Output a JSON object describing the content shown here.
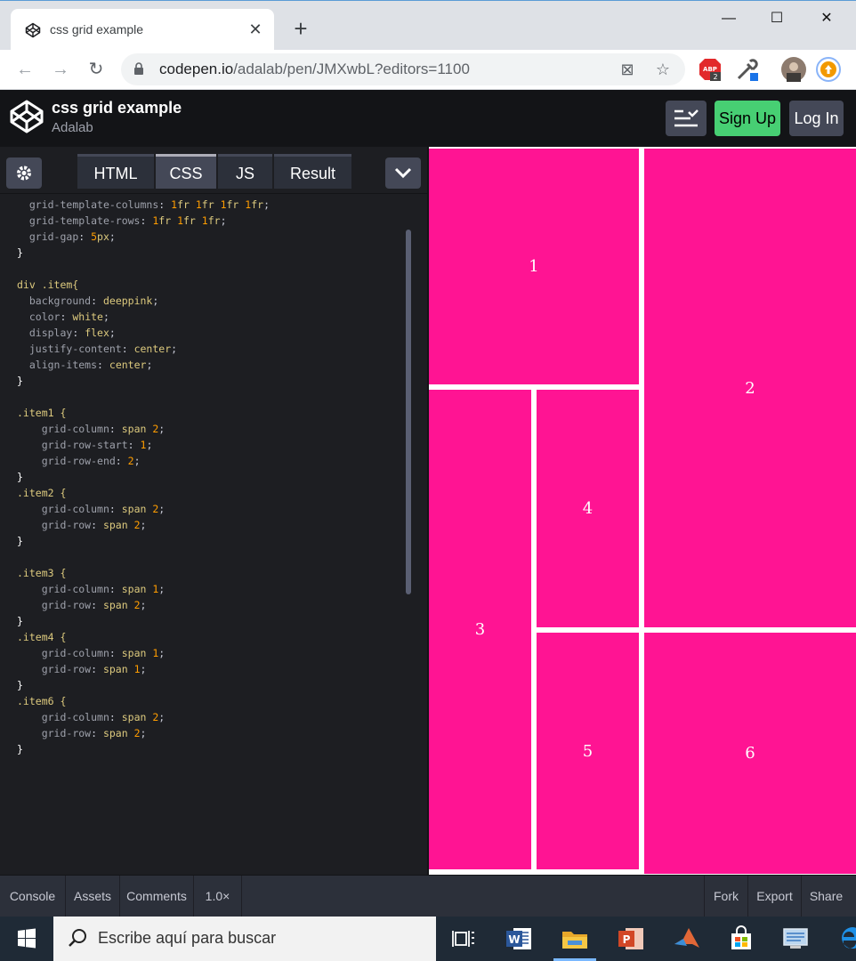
{
  "browser": {
    "tab_title": "css grid example",
    "tab_close": "✕",
    "new_tab": "+",
    "url_host": "codepen.io",
    "url_path": "/adalab/pen/JMXwbL?editors=1100",
    "window_controls": {
      "minimize": "—",
      "maximize": "☐",
      "close": "✕"
    },
    "extension_badge": "2"
  },
  "codepen": {
    "title": "css grid example",
    "author": "Adalab",
    "signup_label": "Sign Up",
    "login_label": "Log In",
    "editor_tabs": [
      "HTML",
      "CSS",
      "JS",
      "Result"
    ],
    "active_tab": "CSS"
  },
  "css_code": [
    "  grid-template-columns: 1fr 1fr 1fr 1fr;",
    "  grid-template-rows: 1fr 1fr 1fr;",
    "  grid-gap: 5px;",
    "}",
    "",
    "div .item{",
    "  background: deeppink;",
    "  color: white;",
    "  display: flex;",
    "  justify-content: center;",
    "  align-items: center;",
    "}",
    "",
    ".item1 {",
    "    grid-column: span 2;",
    "    grid-row-start: 1;",
    "    grid-row-end: 2;",
    "}",
    ".item2 {",
    "    grid-column: span 2;",
    "    grid-row: span 2;",
    "}",
    "",
    ".item3 {",
    "    grid-column: span 1;",
    "    grid-row: span 2;",
    "}",
    ".item4 {",
    "    grid-column: span 1;",
    "    grid-row: span 1;",
    "}",
    ".item6 {",
    "    grid-column: span 2;",
    "    grid-row: span 2;",
    "}"
  ],
  "result_items": [
    "1",
    "2",
    "3",
    "4",
    "5",
    "6"
  ],
  "result_color": "#ff1493",
  "footer": {
    "console": "Console",
    "assets": "Assets",
    "comments": "Comments",
    "zoom": "1.0×",
    "fork": "Fork",
    "export": "Export",
    "share": "Share"
  },
  "taskbar": {
    "search_placeholder": "Escribe aquí para buscar",
    "apps": [
      "task-view-icon",
      "word-icon",
      "file-explorer-icon",
      "powerpoint-icon",
      "matlab-icon",
      "store-icon",
      "control-panel-icon",
      "edge-icon"
    ]
  }
}
